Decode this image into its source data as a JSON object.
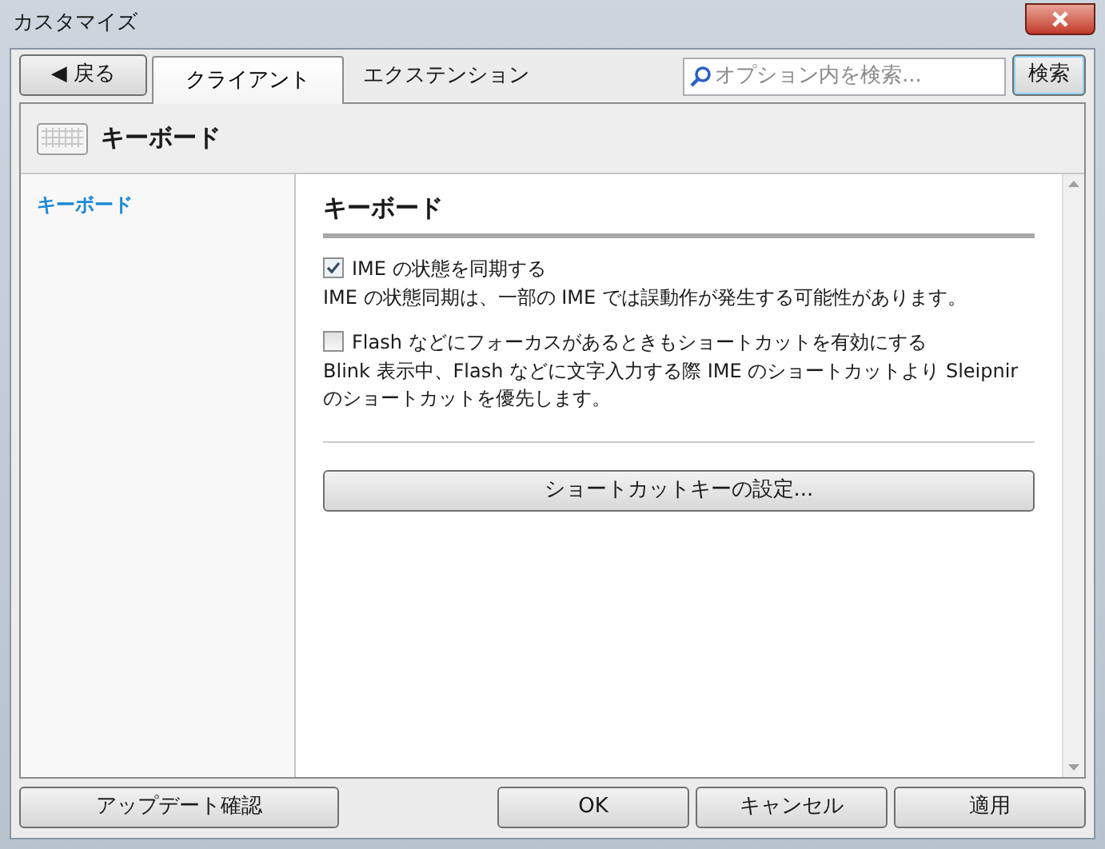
{
  "window": {
    "title": "カスタマイズ"
  },
  "back_button": "◀ 戻る",
  "tabs": [
    {
      "label": "クライアント",
      "selected": true
    },
    {
      "label": "エクステンション",
      "selected": false
    }
  ],
  "search": {
    "placeholder": "オプション内を検索...",
    "button": "検索"
  },
  "header": {
    "title": "キーボード"
  },
  "sidebar": {
    "items": [
      {
        "label": "キーボード",
        "selected": true
      }
    ]
  },
  "section": {
    "title": "キーボード",
    "options": [
      {
        "label": "IME の状態を同期する",
        "checked": true,
        "description": "IME の状態同期は、一部の IME では誤動作が発生する可能性があります。"
      },
      {
        "label": "Flash などにフォーカスがあるときもショートカットを有効にする",
        "checked": false,
        "description": "Blink 表示中、Flash などに文字入力する際 IME のショートカットより Sleipnir のショートカットを優先します。"
      }
    ],
    "button": "ショートカットキーの設定..."
  },
  "footer": {
    "update_button": "アップデート確認",
    "buttons": [
      "OK",
      "キャンセル",
      "適用"
    ]
  }
}
